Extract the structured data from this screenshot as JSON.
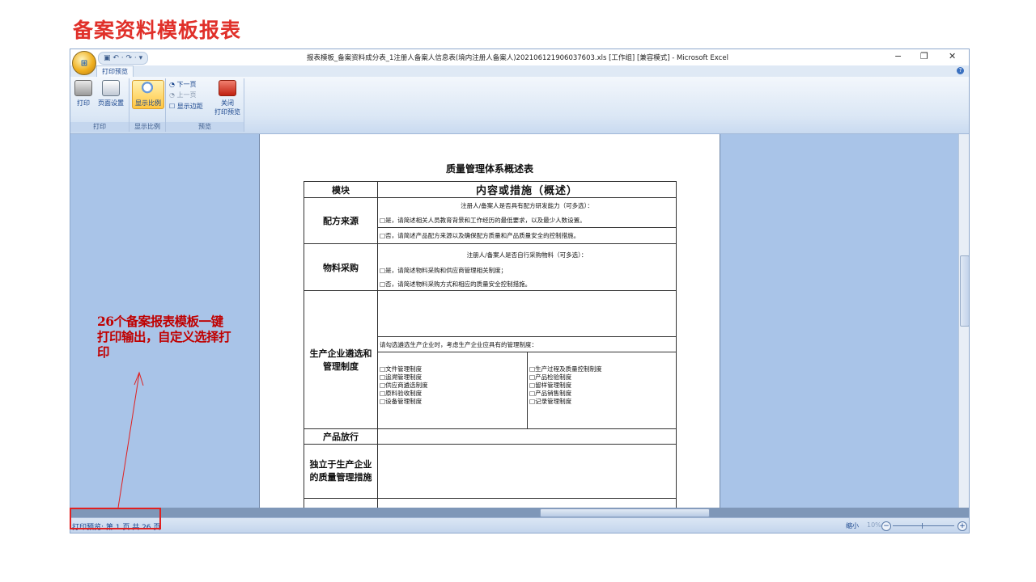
{
  "slide": {
    "title": "备案资料模板报表",
    "annotation": "26个备案报表模板一键打印输出，自定义选择打印"
  },
  "window": {
    "title": "报表模板_备案资料成分表_1注册人备案人信息表(境内注册人备案人)20210612190603760​3.xls [工作组] [兼容模式] - Microsoft Excel",
    "minimize": "−",
    "restore": "❐",
    "close": "✕",
    "qat": "▣ ↶ · ↷ · ▾",
    "office_button": "Office"
  },
  "tabs": {
    "active": "打印预览",
    "help": "?"
  },
  "ribbon": {
    "print": {
      "print_label": "打印",
      "setup_label": "页面设置",
      "group": "打印"
    },
    "zoom": {
      "label": "显示比例",
      "group": "显示比例"
    },
    "preview": {
      "next": "下一页",
      "prev": "上一页",
      "margins": "显示边距",
      "close_line1": "关闭",
      "close_line2": "打印预览",
      "group": "预览"
    }
  },
  "document": {
    "title": "质量管理体系概述表",
    "header_module": "模块",
    "header_content": "内容或措施（概述）",
    "rows": {
      "formula": {
        "label": "配方来源",
        "line1": "注册人/备案人是否具有配方研发能力（可多选）：",
        "line2": "□是，请简述相关人员教育背景和工作经历的最低要求，以及最少人数设置。",
        "line3": "□否，请简述产品配方来源以及确保配方质量和产品质量安全的控制措施。"
      },
      "procurement": {
        "label": "物料采购",
        "line1": "注册人/备案人是否自行采购物料（可多选）：",
        "line2": "□是，请简述物料采购和供应商管理相关制度；",
        "line3": "□否，请简述物料采购方式和相应的质量安全控制措施。"
      },
      "production": {
        "label": "生产企业遴选和管理制度",
        "prompt": "请勾选遴选生产企业时，考虑生产企业应具有的管理制度：",
        "left": [
          "□文件管理制度",
          "□追溯管理制度",
          "□供应商遴选制度",
          "□原料验收制度",
          "□设备管理制度"
        ],
        "right": [
          "□生产过程及质量控制制度",
          "□产品检验制度",
          "□留样管理制度",
          "□产品销售制度",
          "□记录管理制度"
        ]
      },
      "release": {
        "label": "产品放行"
      },
      "independent": {
        "label": "独立于生产企业的质量管理措施"
      }
    }
  },
  "status": {
    "text": "打印预览: 第 1 页 共 26 页",
    "zoom_label": "缩小",
    "zoom_pct": "10%",
    "zoom_minus": "−",
    "zoom_plus": "+"
  }
}
